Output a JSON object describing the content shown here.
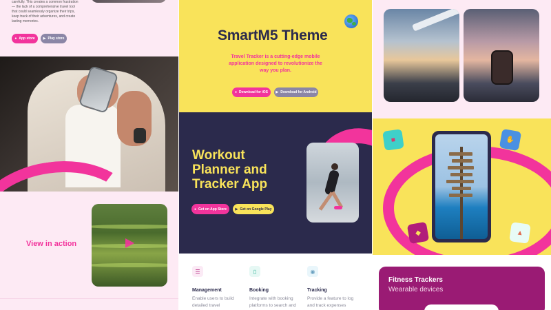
{
  "left": {
    "intro_text": "carefully. This creates a common frustration — the lack of a comprehensive travel tool that could seamlessly organize their trips, keep track of their adventures, and create lasting memories.",
    "btn_app_store": "App store",
    "btn_play_store": "Play store",
    "view_in_action": "View in action"
  },
  "mid": {
    "title": "SmartM5 Theme",
    "description": "Travel Tracker is a cutting-edge mobile application designed to revolutionize the way you plan.",
    "btn_ios": "Download for iOS",
    "btn_android": "Download for Android",
    "workout_title": "Workout Planner and Tracker App",
    "btn_get_app_store": "Get on App Store",
    "btn_get_google_play": "Get on Google Play",
    "features": [
      {
        "title": "Management",
        "desc": "Enable users to build detailed travel",
        "icon": "layers-icon"
      },
      {
        "title": "Booking",
        "desc": "Integrate with booking platforms to search and",
        "icon": "document-icon"
      },
      {
        "title": "Tracking",
        "desc": "Provide a feature to log and track expenses",
        "icon": "eye-icon"
      }
    ]
  },
  "right": {
    "fitness_title": "Fitness Trackers",
    "fitness_subtitle": "Wearable devices"
  },
  "colors": {
    "pink": "#f2349c",
    "yellow": "#f9e35a",
    "navy": "#2b2a4c",
    "lavender": "#8b86a6",
    "blush": "#fdeaf4",
    "plum": "#9a1b74"
  }
}
